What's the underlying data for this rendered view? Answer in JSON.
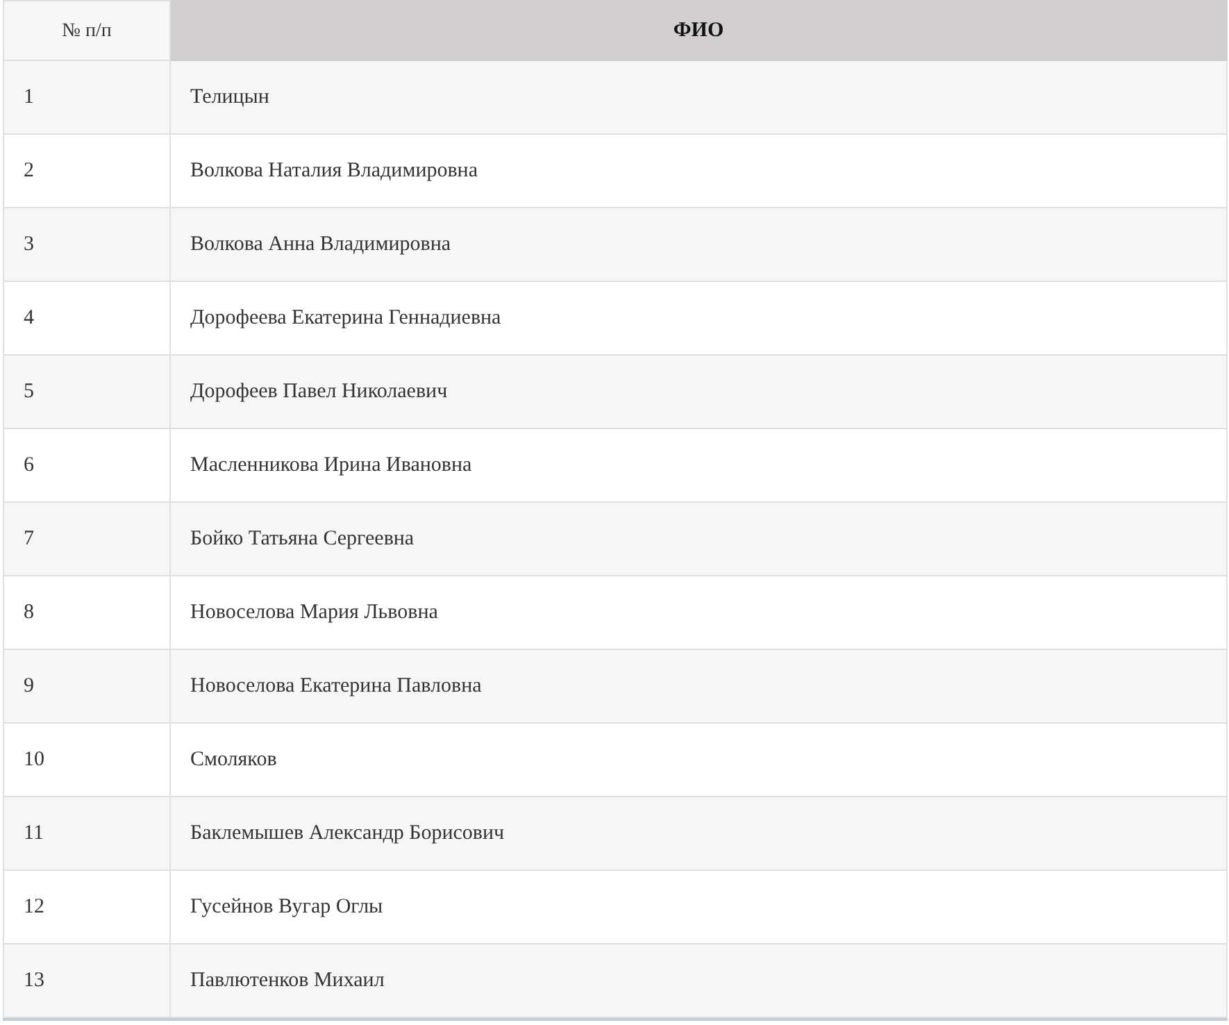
{
  "table": {
    "columns": [
      "№ п/п",
      "ФИО"
    ],
    "rows": [
      {
        "number": "1",
        "name": "Телицын"
      },
      {
        "number": "2",
        "name": "Волкова Наталия Владимировна"
      },
      {
        "number": "3",
        "name": "Волкова Анна Владимировна"
      },
      {
        "number": "4",
        "name": "Дорофеева Екатерина Геннадиевна"
      },
      {
        "number": "5",
        "name": "Дорофеев Павел Николаевич"
      },
      {
        "number": "6",
        "name": "Масленникова Ирина Ивановна"
      },
      {
        "number": "7",
        "name": "Бойко Татьяна Сергеевна"
      },
      {
        "number": "8",
        "name": "Новоселова Мария Львовна"
      },
      {
        "number": "9",
        "name": "Новоселова Екатерина Павловна"
      },
      {
        "number": "10",
        "name": "Смоляков"
      },
      {
        "number": "11",
        "name": "Баклемышев Александр Борисович"
      },
      {
        "number": "12",
        "name": "Гусейнов Вугар Оглы"
      },
      {
        "number": "13",
        "name": "Павлютенков Михаил"
      }
    ]
  }
}
